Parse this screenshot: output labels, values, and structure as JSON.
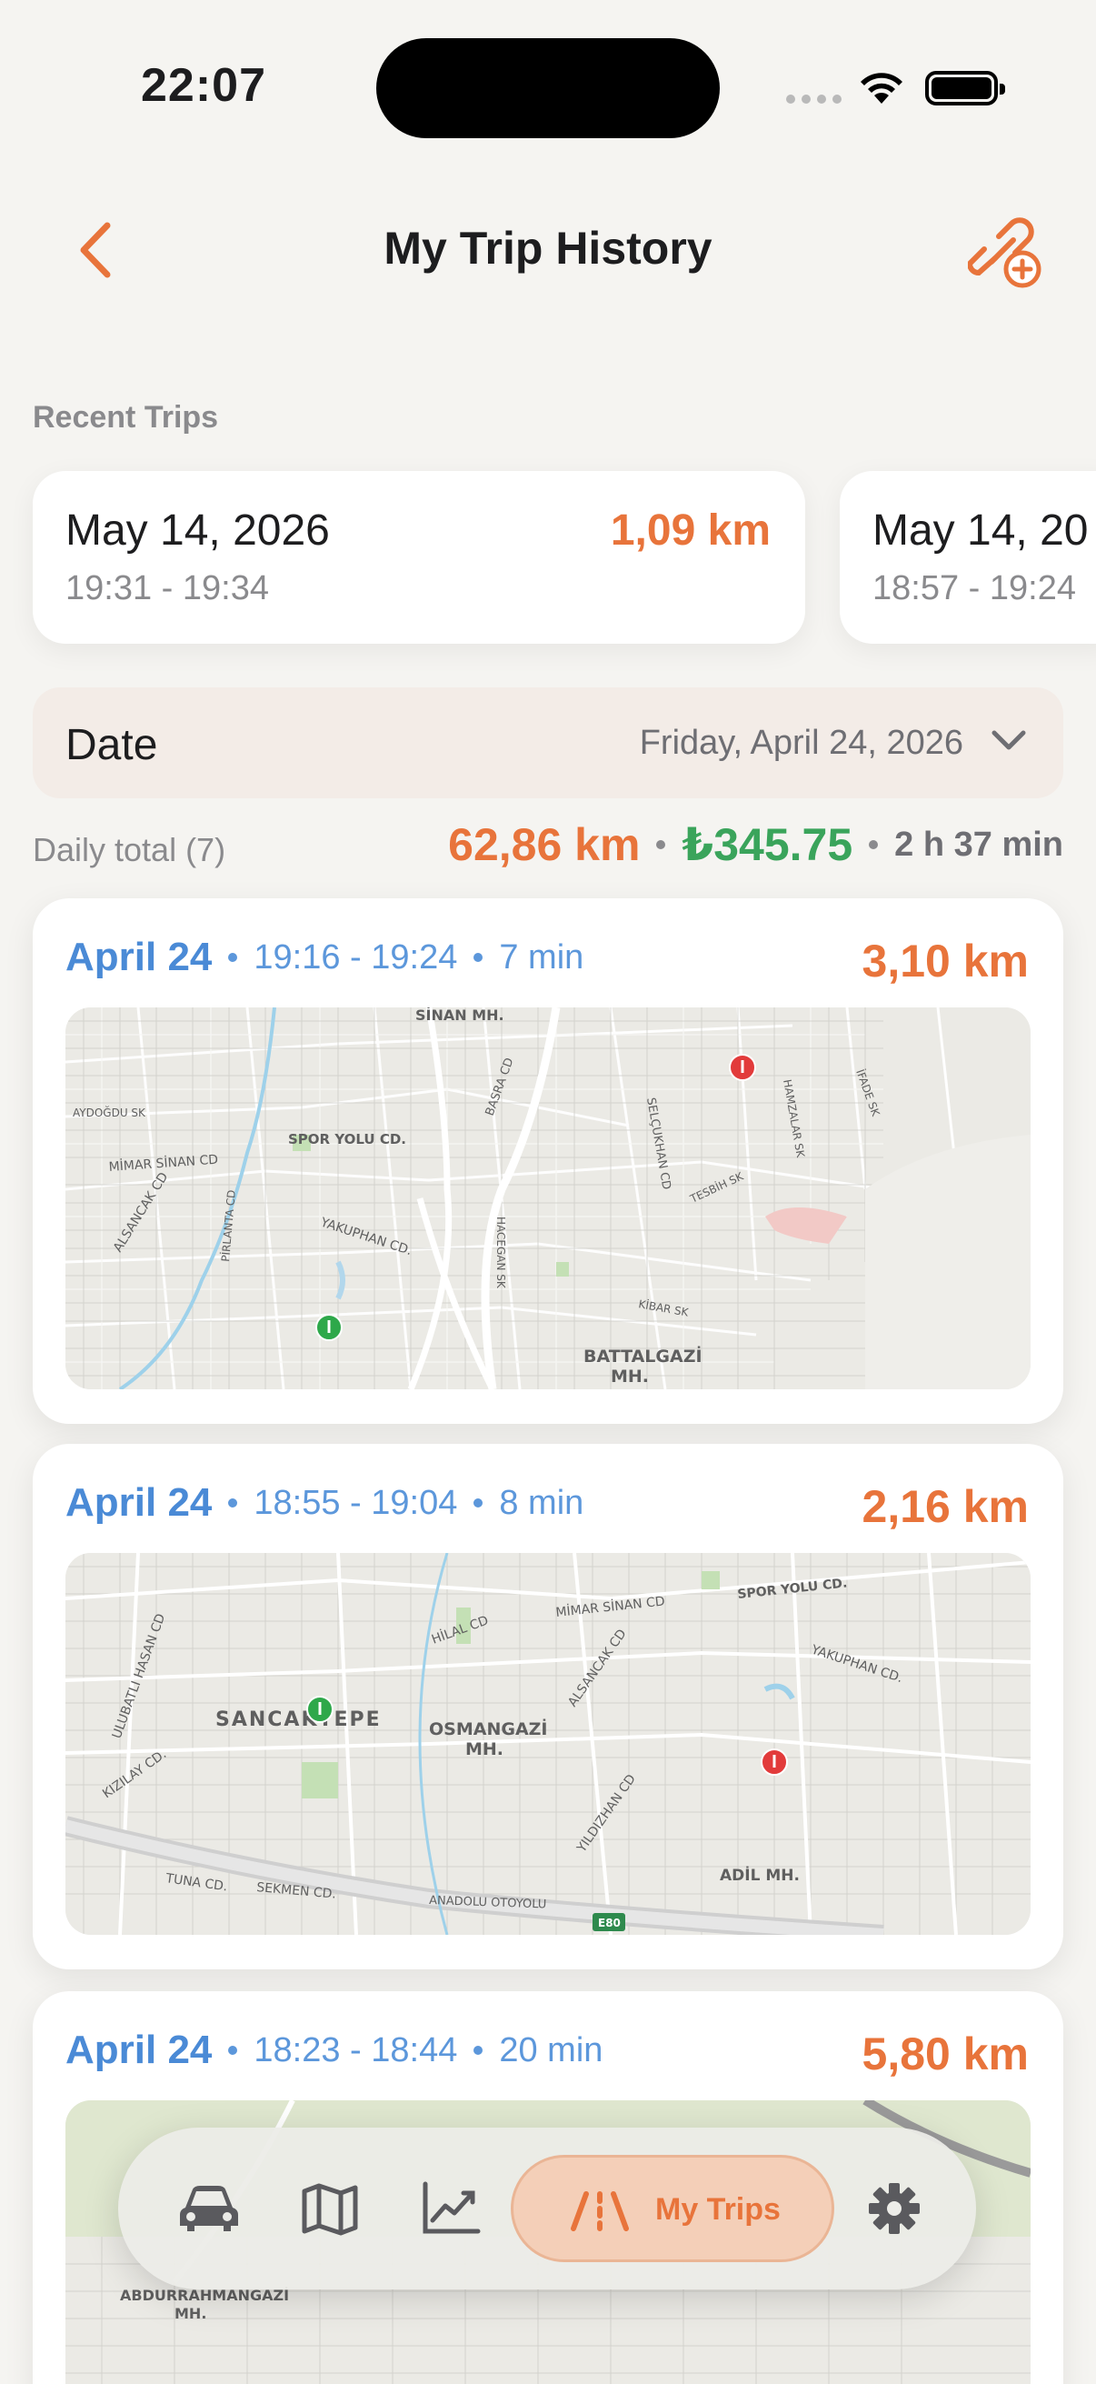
{
  "status": {
    "time": "22:07"
  },
  "header": {
    "title": "My Trip History"
  },
  "recent": {
    "label": "Recent Trips",
    "items": [
      {
        "date": "May 14, 2026",
        "time": "19:31 - 19:34",
        "distance": "1,09 km"
      },
      {
        "date": "May 14, 20",
        "time": "18:57 - 19:24",
        "distance": ""
      }
    ]
  },
  "date_filter": {
    "label": "Date",
    "value": "Friday, April 24, 2026"
  },
  "daily_total": {
    "label": "Daily total (7)",
    "distance": "62,86 km",
    "cost": "₺345.75",
    "duration": "2 h 37 min"
  },
  "trips": [
    {
      "day": "April 24",
      "time": "19:16 - 19:24",
      "duration": "7 min",
      "distance": "3,10 km",
      "map_labels": [
        "SİNAN MH.",
        "SPOR YOLU CD.",
        "MİMAR SİNAN CD",
        "YAKUPHAN CD.",
        "BATTALGAZİ",
        "MH.",
        "ALSANCAK CD",
        "SELÇUKHAN CD",
        "HACEGAN SK",
        "BASRA CD",
        "KİBAR SK",
        "TESBİH SK",
        "AYDOĞDU SK",
        "PİRLANTA CD",
        "İFADE SK",
        "HAMZALAR SK"
      ]
    },
    {
      "day": "April 24",
      "time": "18:55 - 19:04",
      "duration": "8 min",
      "distance": "2,16 km",
      "map_labels": [
        "SANCAKTEPE",
        "OSMANGAZİ",
        "MH.",
        "MİMAR SİNAN CD",
        "SPOR YOLU CD.",
        "YAKUPHAN CD.",
        "ADİL MH.",
        "ANADOLU OTOYOLU",
        "E80",
        "TUNA CD.",
        "SEKMEN CD.",
        "ULUBATLI HASAN CD",
        "KIZILAY CD.",
        "HİLAL CD",
        "ALSANCAK CD",
        "YILDIZHAN CD"
      ]
    },
    {
      "day": "April 24",
      "time": "18:23 - 18:44",
      "duration": "20 min",
      "distance": "5,80 km",
      "map_labels": [
        "ABDURRAHMANGAZİ",
        "MH."
      ]
    }
  ],
  "tabbar": {
    "items": [
      {
        "icon": "car-icon"
      },
      {
        "icon": "map-icon"
      },
      {
        "icon": "chart-icon"
      },
      {
        "icon": "road-icon",
        "label": "My Trips"
      },
      {
        "icon": "gear-icon"
      }
    ]
  },
  "colors": {
    "accent": "#e8743b",
    "blue": "#4a8ad6",
    "green": "#3aa45b",
    "background": "#f5f4f1"
  }
}
